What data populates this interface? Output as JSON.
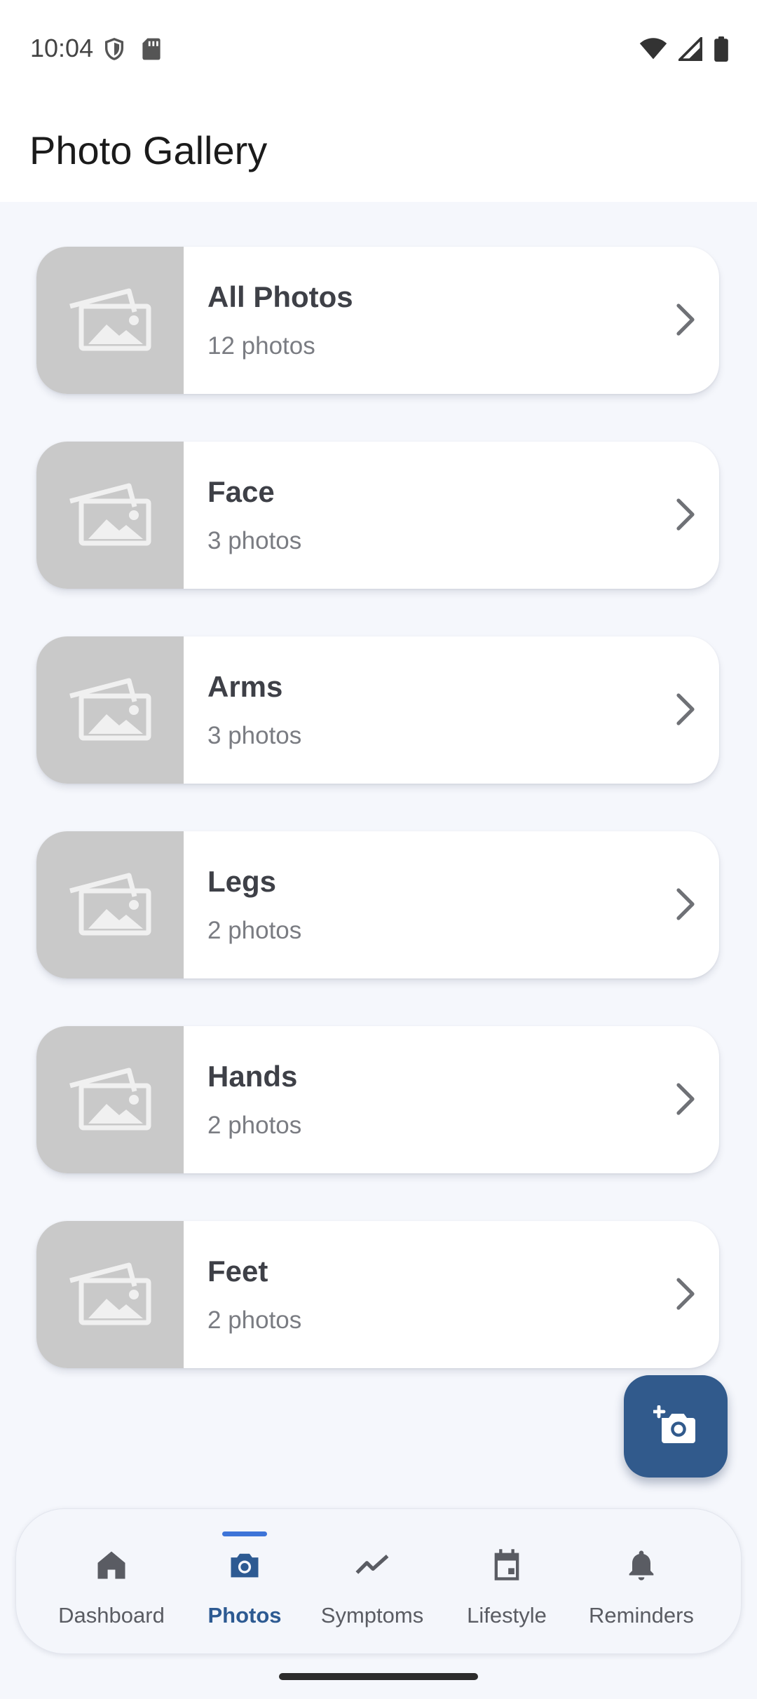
{
  "status_bar": {
    "time": "10:04",
    "left_icons": [
      "shield-icon",
      "sd-card-icon"
    ],
    "right_icons": [
      "wifi-icon",
      "signal-icon",
      "battery-icon"
    ]
  },
  "header": {
    "title": "Photo Gallery"
  },
  "albums": [
    {
      "name": "All Photos",
      "count": "12 photos"
    },
    {
      "name": "Face",
      "count": "3 photos"
    },
    {
      "name": "Arms",
      "count": "3 photos"
    },
    {
      "name": "Legs",
      "count": "2 photos"
    },
    {
      "name": "Hands",
      "count": "2 photos"
    },
    {
      "name": "Feet",
      "count": "2 photos"
    }
  ],
  "fab": {
    "icon": "add-photo-camera-icon"
  },
  "bottom_nav": {
    "active": "Photos",
    "items": [
      {
        "label": "Dashboard",
        "icon": "home-icon"
      },
      {
        "label": "Photos",
        "icon": "camera-icon"
      },
      {
        "label": "Symptoms",
        "icon": "trend-line-icon"
      },
      {
        "label": "Lifestyle",
        "icon": "calendar-icon"
      },
      {
        "label": "Reminders",
        "icon": "bell-icon"
      }
    ]
  },
  "colors": {
    "accent": "#315a8c",
    "active_indicator": "#3d74d8",
    "background": "#f5f7fc",
    "thumbnail": "#c9c9c9"
  }
}
